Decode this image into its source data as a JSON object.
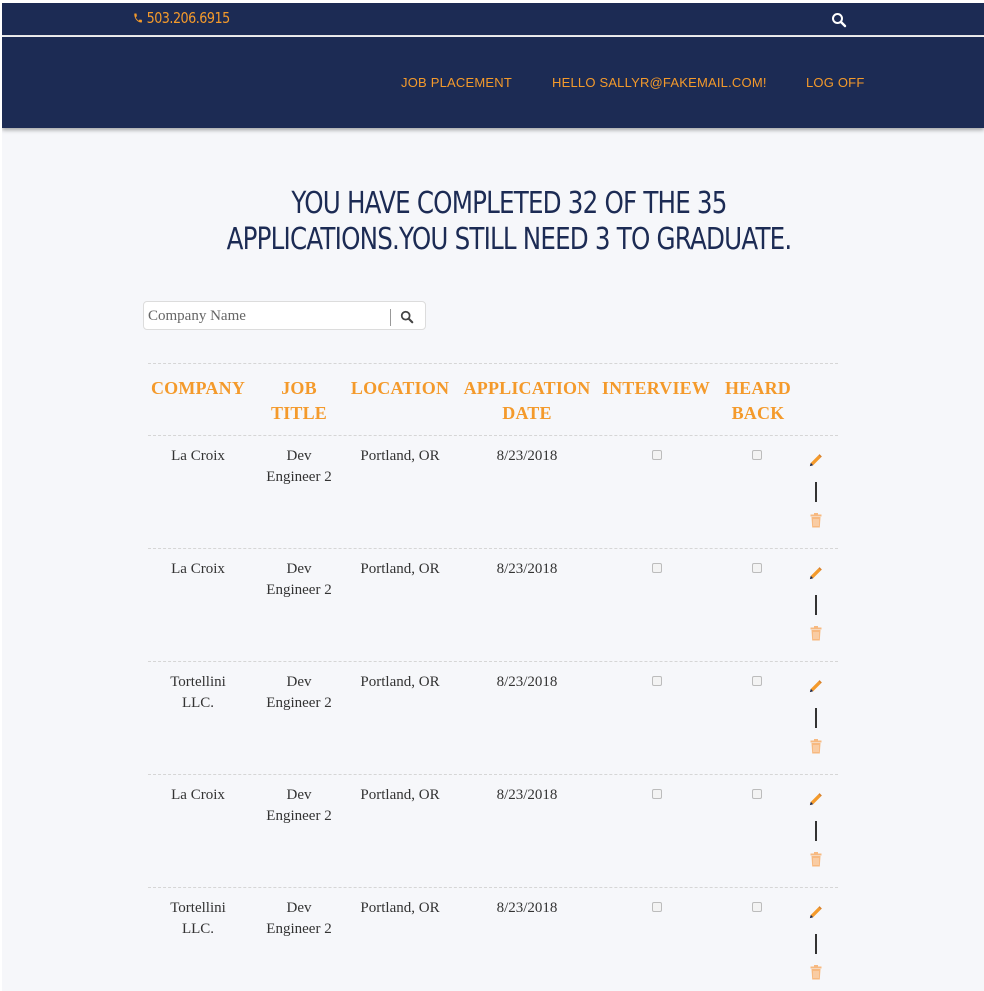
{
  "topbar": {
    "phone": "503.206.6915",
    "phone_icon": "phone-icon",
    "search_icon": "search-icon"
  },
  "nav": {
    "items": [
      {
        "label": "JOB PLACEMENT"
      },
      {
        "label": "HELLO SALLYR@FAKEMAIL.COM!"
      },
      {
        "label": "LOG OFF"
      }
    ]
  },
  "heading": "YOU HAVE COMPLETED 32 OF THE 35 APPLICATIONS.YOU STILL NEED 3 TO GRADUATE.",
  "search": {
    "placeholder": "Company Name",
    "value": ""
  },
  "table": {
    "headers": {
      "company": "COMPANY",
      "job_title_1": "JOB",
      "job_title_2": "TITLE",
      "location": "LOCATION",
      "application_date_1": "APPLICATION",
      "application_date_2": "DATE",
      "interview": "INTERVIEW",
      "heard_back_1": "HEARD",
      "heard_back_2": "BACK"
    },
    "rows": [
      {
        "company_1": "La Croix",
        "company_2": "",
        "title_1": "Dev",
        "title_2": "Engineer 2",
        "location": "Portland, OR",
        "date": "8/23/2018",
        "interview": false,
        "heard_back": false
      },
      {
        "company_1": "La Croix",
        "company_2": "",
        "title_1": "Dev",
        "title_2": "Engineer 2",
        "location": "Portland, OR",
        "date": "8/23/2018",
        "interview": false,
        "heard_back": false
      },
      {
        "company_1": "Tortellini",
        "company_2": "LLC.",
        "title_1": "Dev",
        "title_2": "Engineer 2",
        "location": "Portland, OR",
        "date": "8/23/2018",
        "interview": false,
        "heard_back": false
      },
      {
        "company_1": "La Croix",
        "company_2": "",
        "title_1": "Dev",
        "title_2": "Engineer 2",
        "location": "Portland, OR",
        "date": "8/23/2018",
        "interview": false,
        "heard_back": false
      },
      {
        "company_1": "Tortellini",
        "company_2": "LLC.",
        "title_1": "Dev",
        "title_2": "Engineer 2",
        "location": "Portland, OR",
        "date": "8/23/2018",
        "interview": false,
        "heard_back": false
      }
    ],
    "action_icons": {
      "edit": "pencil-icon",
      "delete": "trash-icon"
    }
  },
  "colors": {
    "navy": "#1c2b54",
    "accent": "#f49a2b",
    "background": "#f6f7fa"
  }
}
